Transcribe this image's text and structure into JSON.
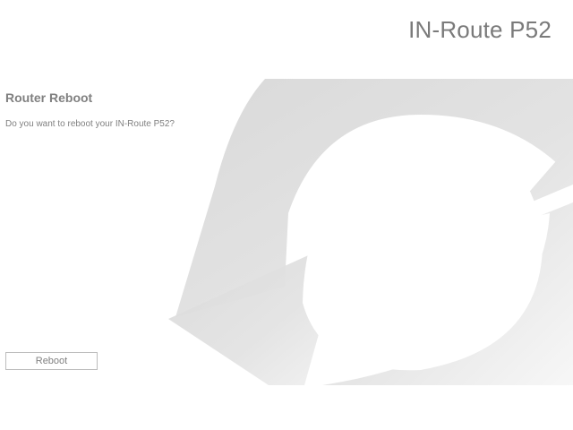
{
  "header": {
    "product_name": "IN-Route P52"
  },
  "reboot_panel": {
    "title": "Router Reboot",
    "question": "Do you want to reboot your IN-Route P52?",
    "button_label": "Reboot"
  },
  "decoration": {
    "arrow_color": "#d9d9d9",
    "background_icon": "refresh-arrows-icon"
  }
}
